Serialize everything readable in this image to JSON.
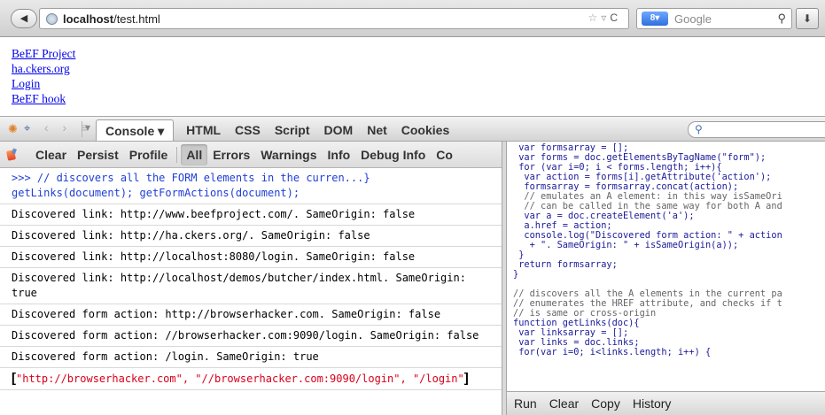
{
  "browser": {
    "url_host": "localhost",
    "url_path": "/test.html",
    "search_engine_badge": "8",
    "search_placeholder": "Google"
  },
  "page_links": [
    "BeEF Project",
    "ha.ckers.org",
    "Login",
    "BeEF hook"
  ],
  "firebug": {
    "tabs": [
      "Console ▾",
      "HTML",
      "CSS",
      "Script",
      "DOM",
      "Net",
      "Cookies"
    ],
    "console_toolbar": [
      "Clear",
      "Persist",
      "Profile",
      "All",
      "Errors",
      "Warnings",
      "Info",
      "Debug Info",
      "Co"
    ],
    "command": [
      ">>> // discovers all the FORM elements in the curren...}",
      "getLinks(document); getFormActions(document);"
    ],
    "log_rows": [
      "Discovered link: http://www.beefproject.com/. SameOrigin: false",
      "Discovered link: http://ha.ckers.org/. SameOrigin: false",
      "Discovered link: http://localhost:8080/login. SameOrigin: false",
      "Discovered link: http://localhost/demos/butcher/index.html. SameOrigin: true",
      "Discovered form action: http://browserhacker.com. SameOrigin: false",
      "Discovered form action: //browserhacker.com:9090/login. SameOrigin: false",
      "Discovered form action: /login. SameOrigin: true"
    ],
    "result": {
      "open": "[",
      "items": [
        "\"http://browserhacker.com\", ",
        "\"//browserhacker.com:9090/login\", ",
        "\"/login\""
      ],
      "close": "]"
    },
    "code_lines": [
      " var formsarray = [];",
      " var forms = doc.getElementsByTagName(\"form\");",
      " for (var i=0; i < forms.length; i++){",
      "  var action = forms[i].getAttribute('action');",
      "  formsarray = formsarray.concat(action);",
      "  // emulates an A element: in this way isSameOri",
      "  // can be called in the same way for both A and",
      "  var a = doc.createElement('a');",
      "  a.href = action;",
      "  console.log(\"Discovered form action: \" + action",
      "   + \". SameOrigin: \" + isSameOrigin(a));",
      " }",
      " return formsarray;",
      "}",
      "",
      "// discovers all the A elements in the current pa",
      "// enumerates the HREF attribute, and checks if t",
      "// is same or cross-origin",
      "function getLinks(doc){",
      " var linksarray = [];",
      " var links = doc.links;",
      " for(var i=0; i<links.length; i++) {"
    ],
    "code_buttons": [
      "Run",
      "Clear",
      "Copy",
      "History"
    ]
  }
}
